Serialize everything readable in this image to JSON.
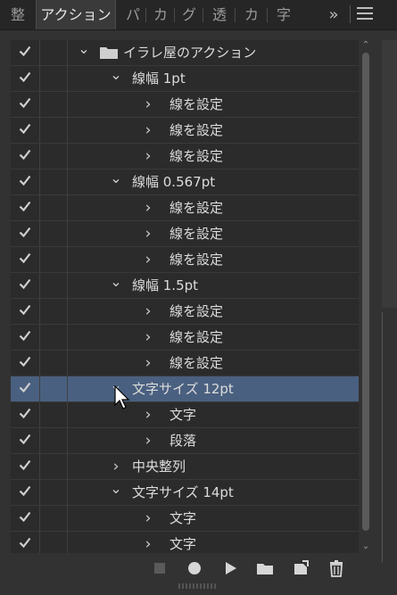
{
  "tabs": [
    {
      "label": "整",
      "active": false
    },
    {
      "label": "アクション",
      "active": true
    },
    {
      "label": "パ",
      "active": false
    },
    {
      "label": "カ",
      "active": false
    },
    {
      "label": "グ",
      "active": false
    },
    {
      "label": "透",
      "active": false
    },
    {
      "label": "カ",
      "active": false
    },
    {
      "label": "字",
      "active": false
    }
  ],
  "overflow_label": "»",
  "rows": [
    {
      "level": 0,
      "expanded": true,
      "folder": true,
      "label": "イラレ屋のアクション",
      "checked": true,
      "selected": false
    },
    {
      "level": 1,
      "expanded": true,
      "folder": false,
      "label": "線幅 1pt",
      "checked": true,
      "selected": false
    },
    {
      "level": 2,
      "expanded": false,
      "folder": false,
      "label": "線を設定",
      "checked": true,
      "selected": false
    },
    {
      "level": 2,
      "expanded": false,
      "folder": false,
      "label": "線を設定",
      "checked": true,
      "selected": false
    },
    {
      "level": 2,
      "expanded": false,
      "folder": false,
      "label": "線を設定",
      "checked": true,
      "selected": false
    },
    {
      "level": 1,
      "expanded": true,
      "folder": false,
      "label": "線幅 0.567pt",
      "checked": true,
      "selected": false
    },
    {
      "level": 2,
      "expanded": false,
      "folder": false,
      "label": "線を設定",
      "checked": true,
      "selected": false
    },
    {
      "level": 2,
      "expanded": false,
      "folder": false,
      "label": "線を設定",
      "checked": true,
      "selected": false
    },
    {
      "level": 2,
      "expanded": false,
      "folder": false,
      "label": "線を設定",
      "checked": true,
      "selected": false
    },
    {
      "level": 1,
      "expanded": true,
      "folder": false,
      "label": "線幅 1.5pt",
      "checked": true,
      "selected": false
    },
    {
      "level": 2,
      "expanded": false,
      "folder": false,
      "label": "線を設定",
      "checked": true,
      "selected": false
    },
    {
      "level": 2,
      "expanded": false,
      "folder": false,
      "label": "線を設定",
      "checked": true,
      "selected": false
    },
    {
      "level": 2,
      "expanded": false,
      "folder": false,
      "label": "線を設定",
      "checked": true,
      "selected": false
    },
    {
      "level": 1,
      "expanded": true,
      "folder": false,
      "label": "文字サイズ 12pt",
      "checked": true,
      "selected": true
    },
    {
      "level": 2,
      "expanded": false,
      "folder": false,
      "label": "文字",
      "checked": true,
      "selected": false
    },
    {
      "level": 2,
      "expanded": false,
      "folder": false,
      "label": "段落",
      "checked": true,
      "selected": false
    },
    {
      "level": 1,
      "expanded": false,
      "folder": false,
      "label": "中央整列",
      "checked": true,
      "selected": false
    },
    {
      "level": 1,
      "expanded": true,
      "folder": false,
      "label": "文字サイズ 14pt",
      "checked": true,
      "selected": false
    },
    {
      "level": 2,
      "expanded": false,
      "folder": false,
      "label": "文字",
      "checked": true,
      "selected": false
    },
    {
      "level": 2,
      "expanded": false,
      "folder": false,
      "label": "文字",
      "checked": true,
      "selected": false
    }
  ],
  "toolbar": [
    {
      "name": "stop-recording-icon",
      "enabled": false
    },
    {
      "name": "record-icon",
      "enabled": true
    },
    {
      "name": "play-icon",
      "enabled": true
    },
    {
      "name": "new-set-folder-icon",
      "enabled": true
    },
    {
      "name": "new-action-icon",
      "enabled": true
    },
    {
      "name": "delete-trash-icon",
      "enabled": true
    }
  ],
  "colors": {
    "selected_row": "#4a6080",
    "panel_bg": "#323232",
    "list_bg": "#2b2b2b"
  }
}
